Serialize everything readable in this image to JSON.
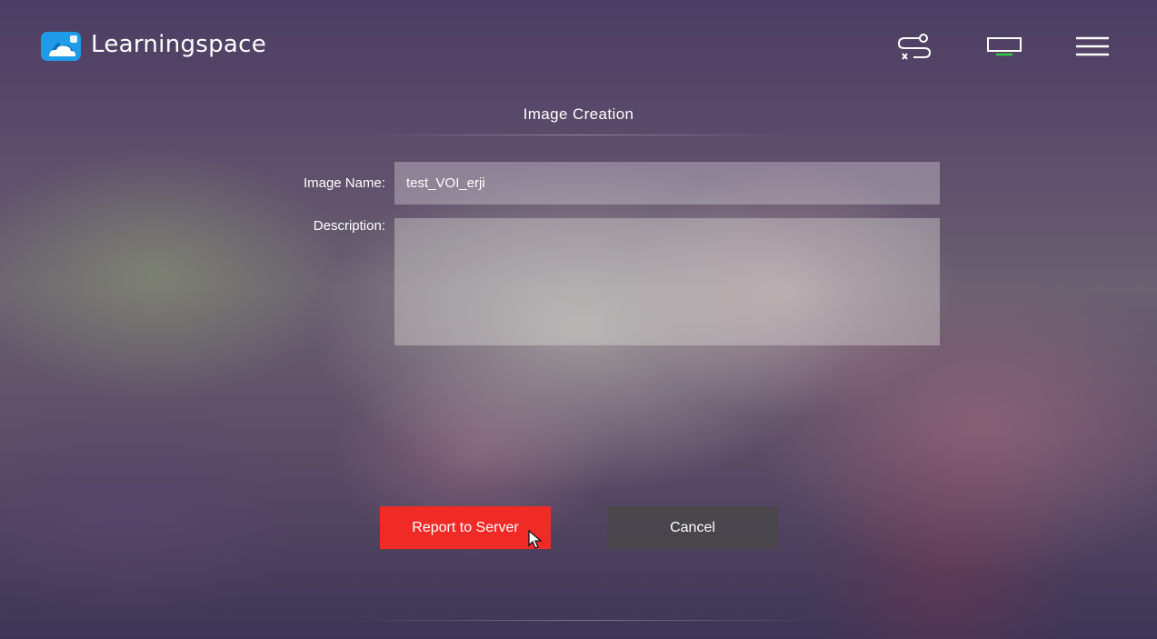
{
  "header": {
    "brand": "Learningspace",
    "icons": [
      "route-icon",
      "display-icon",
      "menu-icon"
    ],
    "logo_colors": {
      "primary": "#1f9be8",
      "cloud": "#ffffff"
    }
  },
  "dialog": {
    "title": "Image Creation",
    "fields": {
      "image_name_label": "Image Name:",
      "image_name_value": "test_VOI_erji",
      "description_label": "Description:",
      "description_value": ""
    },
    "buttons": {
      "report_label": "Report to Server",
      "cancel_label": "Cancel"
    }
  },
  "colors": {
    "primary_button": "#f02b26",
    "secondary_button": "#464646",
    "display_indicator": "#2ecc40"
  }
}
